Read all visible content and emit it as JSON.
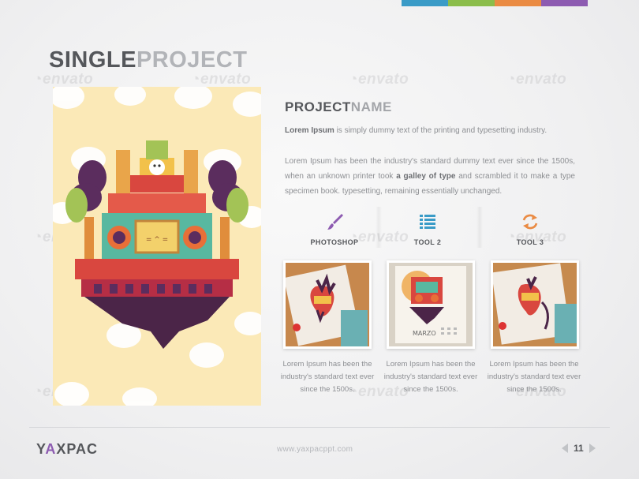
{
  "colors": {
    "bar": [
      "#3a9bc7",
      "#8bbd4b",
      "#ea8b43",
      "#8d5bb1"
    ],
    "title_dark": "#55575b",
    "title_light": "#b2b4b8",
    "brand_accent": "#8d5bb1"
  },
  "title": {
    "part1": "SINGLE",
    "part2": "PROJECT"
  },
  "watermark": "envato",
  "project": {
    "name_part1": "PROJECT",
    "name_part2": "NAME",
    "lead_bold": "Lorem Ipsum",
    "lead_rest": " is simply dummy text of the printing and typesetting industry.",
    "body_1": "Lorem Ipsum has been the industry's standard dummy text ever since the 1500s, when an unknown printer took ",
    "body_bold": "a galley of type",
    "body_2": " and scrambled it to make a type specimen book. typesetting, remaining essentially unchanged."
  },
  "tools": [
    {
      "label": "PHOTOSHOP",
      "icon": "brush-icon"
    },
    {
      "label": "TOOL 2",
      "icon": "list-icon"
    },
    {
      "label": "TOOL 3",
      "icon": "refresh-icon"
    }
  ],
  "thumbnails": [
    {
      "caption": "Lorem Ipsum has been the industry's standard text ever since the 1500s."
    },
    {
      "caption": "Lorem Ipsum has been the industry's standard text ever since the 1500s.",
      "calendar_text": "MARZO"
    },
    {
      "caption": "Lorem Ipsum has been the industry's standard text ever since the 1500s."
    }
  ],
  "footer": {
    "brand_1": "Y",
    "brand_accent": "A",
    "brand_2": "XPAC",
    "url": "www.yaxpacppt.com",
    "page": "11"
  }
}
